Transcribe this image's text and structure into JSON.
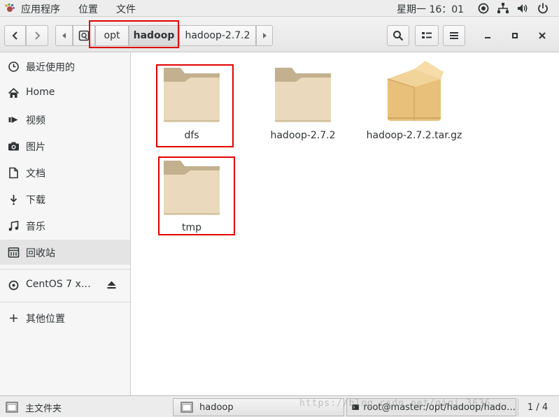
{
  "top_panel": {
    "applications_label": "应用程序",
    "places_label": "位置",
    "file_label": "文件",
    "clock": "星期一 16：01",
    "tray_icons": [
      "accessibility-icon",
      "network-icon",
      "volume-icon",
      "power-icon"
    ]
  },
  "header": {
    "breadcrumbs": [
      {
        "label": "opt",
        "active": false
      },
      {
        "label": "hadoop",
        "active": true
      },
      {
        "label": "hadoop-2.7.2",
        "active": false
      }
    ],
    "toolbar_icons": [
      "search-icon",
      "view-list-icon",
      "menu-icon",
      "minimize-icon",
      "maximize-icon",
      "close-icon"
    ]
  },
  "sidebar": {
    "items": [
      {
        "label": "最近使用的",
        "icon": "recent-icon"
      },
      {
        "label": "Home",
        "icon": "home-icon"
      },
      {
        "label": "视频",
        "icon": "video-icon"
      },
      {
        "label": "图片",
        "icon": "camera-icon"
      },
      {
        "label": "文档",
        "icon": "document-icon"
      },
      {
        "label": "下载",
        "icon": "download-icon"
      },
      {
        "label": "音乐",
        "icon": "music-icon"
      },
      {
        "label": "回收站",
        "icon": "trash-icon",
        "selected": true
      },
      {
        "label": "CentOS 7 x…",
        "icon": "disc-icon"
      },
      {
        "label": "其他位置",
        "icon": "plus-icon"
      }
    ]
  },
  "files": [
    {
      "name": "dfs",
      "type": "folder"
    },
    {
      "name": "hadoop-2.7.2",
      "type": "folder"
    },
    {
      "name": "hadoop-2.7.2.tar.gz",
      "type": "archive"
    },
    {
      "name": "tmp",
      "type": "folder"
    }
  ],
  "taskbar": {
    "home_folder_label": "主文件夹",
    "window_file_manager": "hadoop",
    "window_terminal": "root@master:/opt/hadoop/hado…",
    "workspace": "1 / 4",
    "watermark": "https://blog.csdn.net/qiqi_3636..."
  },
  "colors": {
    "highlight_box": "#e00000",
    "folder_tab": "#c2b08e",
    "folder_body": "#ead9bd",
    "archive": "#e8c07a"
  }
}
